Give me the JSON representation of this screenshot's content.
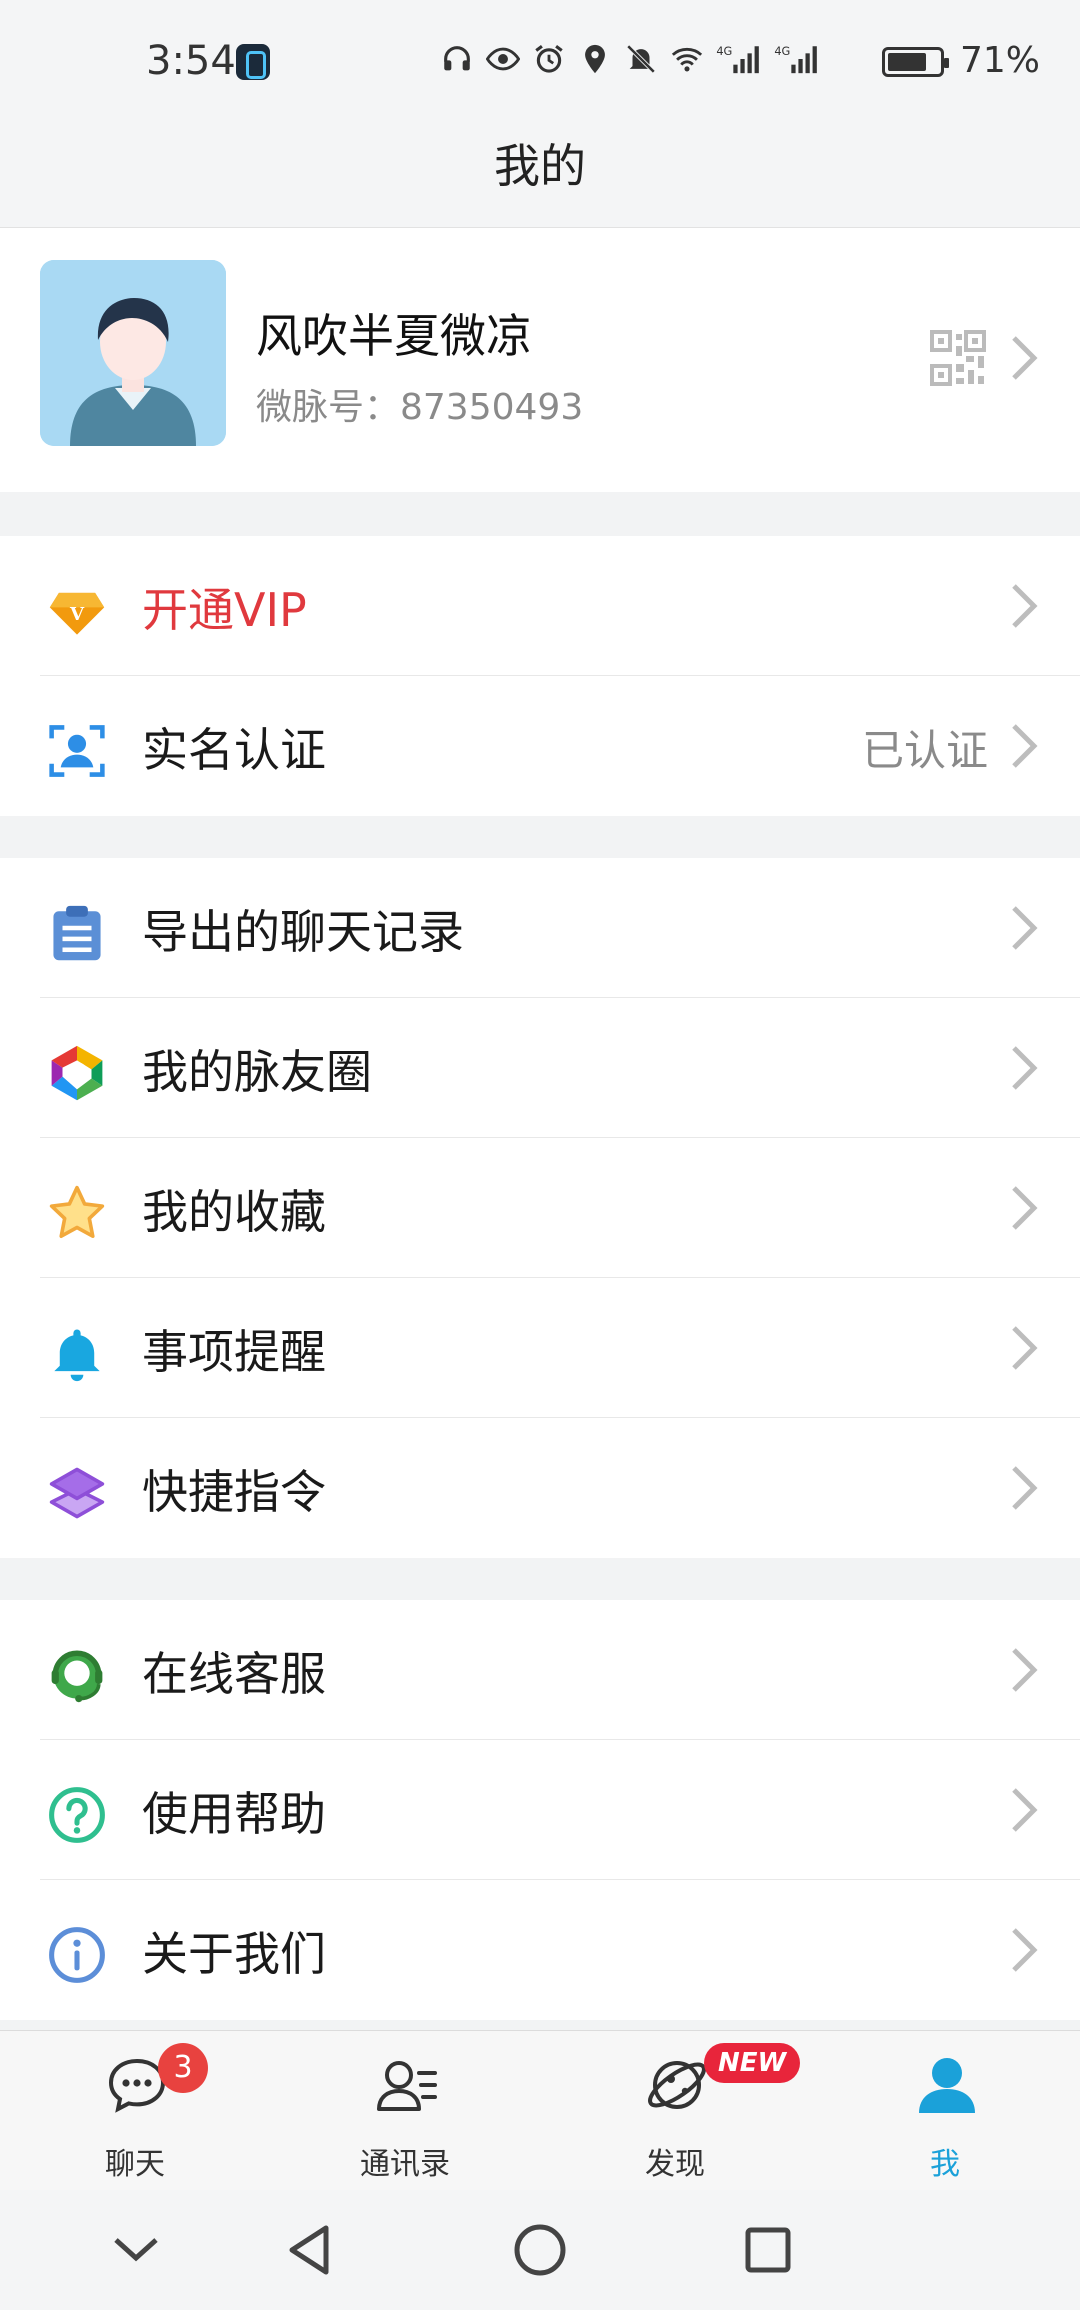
{
  "status_bar": {
    "time": "3:54",
    "battery_text": "71%",
    "icons": [
      "headphones-icon",
      "eye-icon",
      "alarm-icon",
      "location-icon",
      "mute-icon",
      "wifi-icon",
      "signal-4g-icon",
      "signal-4g-icon",
      "battery-icon"
    ]
  },
  "header": {
    "title": "我的"
  },
  "profile": {
    "name": "风吹半夏微凉",
    "id_text": "微脉号：87350493"
  },
  "groups": {
    "g1": {
      "vip": {
        "label": "开通VIP",
        "icon": "vip-diamond-icon"
      },
      "realname": {
        "label": "实名认证",
        "value": "已认证",
        "icon": "id-verify-icon"
      }
    },
    "g2": {
      "export": {
        "label": "导出的聊天记录",
        "icon": "clipboard-icon"
      },
      "moments": {
        "label": "我的脉友圈",
        "icon": "aperture-icon"
      },
      "favorites": {
        "label": "我的收藏",
        "icon": "star-icon"
      },
      "reminders": {
        "label": "事项提醒",
        "icon": "bell-icon"
      },
      "shortcuts": {
        "label": "快捷指令",
        "icon": "layers-icon"
      }
    },
    "g3": {
      "support": {
        "label": "在线客服",
        "icon": "headset-agent-icon"
      },
      "help": {
        "label": "使用帮助",
        "icon": "question-icon"
      },
      "about": {
        "label": "关于我们",
        "icon": "info-icon"
      }
    }
  },
  "tab_bar": {
    "chat": {
      "label": "聊天",
      "badge": "3"
    },
    "contacts": {
      "label": "通讯录"
    },
    "discover": {
      "label": "发现",
      "badge": "NEW"
    },
    "me": {
      "label": "我"
    }
  },
  "colors": {
    "accent": "#1ba1d9",
    "vip_text": "#e0393e",
    "badge": "#e8423f",
    "page_bg": "#f2f3f4"
  }
}
